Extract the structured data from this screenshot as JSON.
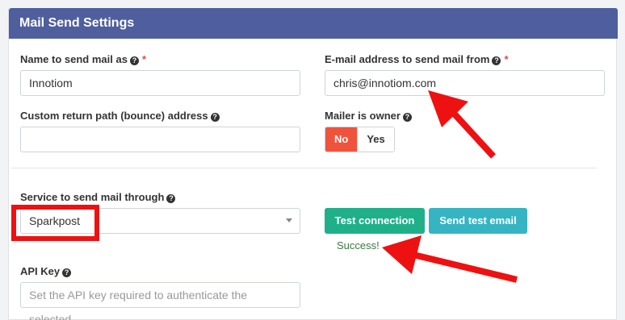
{
  "panel": {
    "title": "Mail Send Settings"
  },
  "fields": {
    "name_label": "Name to send mail as",
    "name_value": "Innotiom",
    "email_label": "E-mail address to send mail from",
    "email_value": "chris@innotiom.com",
    "return_path_label": "Custom return path (bounce) address",
    "return_path_value": "",
    "mailer_owner_label": "Mailer is owner",
    "mailer_owner_options": [
      "No",
      "Yes"
    ],
    "mailer_owner_selected": "No",
    "service_label": "Service to send mail through",
    "service_value": "Sparkpost",
    "api_key_label": "API Key",
    "api_key_placeholder": "Set the API key required to authenticate the selected"
  },
  "buttons": {
    "test_connection": "Test connection",
    "send_test_email": "Send test email"
  },
  "status": {
    "message": "Success!"
  },
  "icons": {
    "help": "help-circle-icon",
    "dropdown": "caret-down-icon"
  },
  "colors": {
    "header": "#4f5f9d",
    "active_toggle": "#f0533c",
    "test_button": "#1fb08a",
    "send_button": "#36b4c2",
    "success_text": "#3c763d",
    "annotation": "#ee1111"
  }
}
